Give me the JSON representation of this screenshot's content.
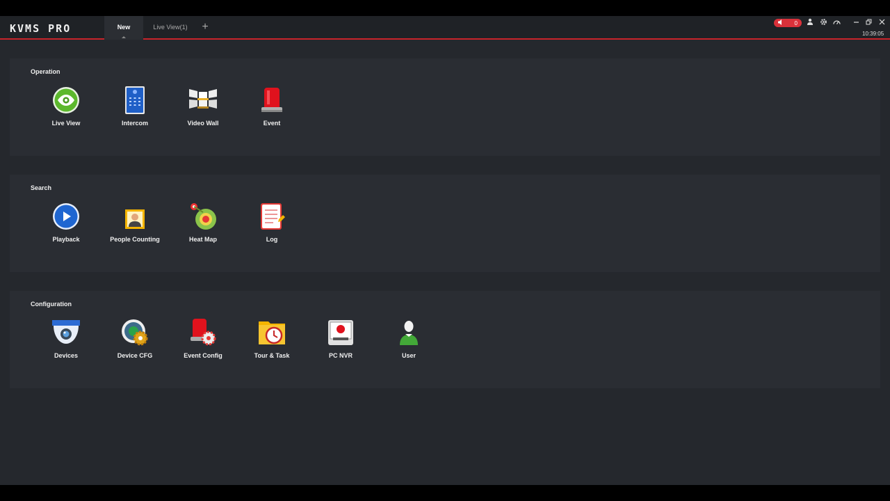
{
  "app": {
    "logo": "KVMS PRO",
    "tabs": [
      {
        "label": "New"
      },
      {
        "label": "Live View(1)"
      }
    ],
    "add_tab": "+",
    "alarm_count": "0",
    "clock": "10:39:05",
    "icons": {
      "alarm": "speaker-icon",
      "user": "user-icon",
      "settings": "gear-icon",
      "performance": "gauge-icon",
      "minimize": "minimize-icon",
      "restore": "restore-icon",
      "close": "close-icon"
    },
    "colors": {
      "accent": "#c8232a",
      "background": "#25282d",
      "panel": "#2a2d33"
    }
  },
  "sections": [
    {
      "title": "Operation",
      "items": [
        {
          "label": "Live View",
          "icon": "eye-icon"
        },
        {
          "label": "Intercom",
          "icon": "intercom-icon"
        },
        {
          "label": "Video Wall",
          "icon": "video-wall-icon"
        },
        {
          "label": "Event",
          "icon": "alarm-light-icon"
        }
      ]
    },
    {
      "title": "Search",
      "items": [
        {
          "label": "Playback",
          "icon": "play-icon"
        },
        {
          "label": "People Counting",
          "icon": "person-icon"
        },
        {
          "label": "Heat Map",
          "icon": "heat-map-icon"
        },
        {
          "label": "Log",
          "icon": "log-icon"
        }
      ]
    },
    {
      "title": "Configuration",
      "items": [
        {
          "label": "Devices",
          "icon": "camera-icon"
        },
        {
          "label": "Device CFG",
          "icon": "device-config-icon"
        },
        {
          "label": "Event Config",
          "icon": "event-config-icon"
        },
        {
          "label": "Tour & Task",
          "icon": "clock-folder-icon"
        },
        {
          "label": "PC NVR",
          "icon": "pc-nvr-icon"
        },
        {
          "label": "User",
          "icon": "user-green-icon"
        }
      ]
    }
  ]
}
